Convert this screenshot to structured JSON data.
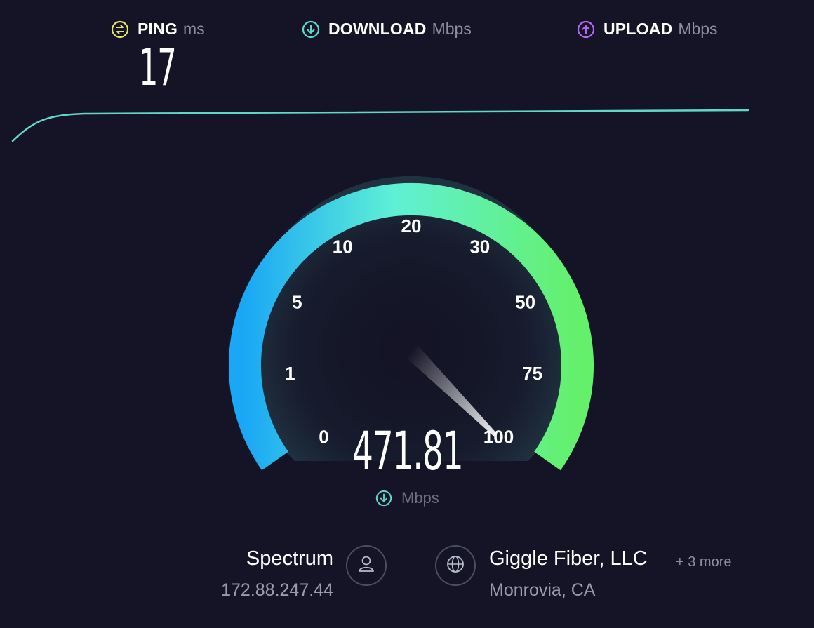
{
  "metrics": {
    "ping": {
      "label": "PING",
      "unit": "ms",
      "value": "17",
      "icon": "ping-icon",
      "color": "#e8e66a"
    },
    "download": {
      "label": "DOWNLOAD",
      "unit": "Mbps",
      "icon": "download-arrow-icon",
      "color": "#5fd8c8"
    },
    "upload": {
      "label": "UPLOAD",
      "unit": "Mbps",
      "icon": "upload-arrow-icon",
      "color": "#b768f0"
    }
  },
  "gauge": {
    "ticks": [
      "0",
      "1",
      "5",
      "10",
      "20",
      "30",
      "50",
      "75",
      "100"
    ],
    "speed": "471.81",
    "unit": "Mbps",
    "needle_tick_fraction": 1.0,
    "colors": {
      "start": "#1aa7f5",
      "mid": "#5ff0d6",
      "end": "#64f06a"
    }
  },
  "isp": {
    "name": "Spectrum",
    "ip": "172.88.247.44",
    "icon": "user-icon"
  },
  "server": {
    "name": "Giggle Fiber, LLC",
    "more": "+ 3 more",
    "location": "Monrovia, CA",
    "icon": "globe-icon"
  },
  "colors": {
    "background": "#141426",
    "trend_line": "#5fd8c8"
  }
}
